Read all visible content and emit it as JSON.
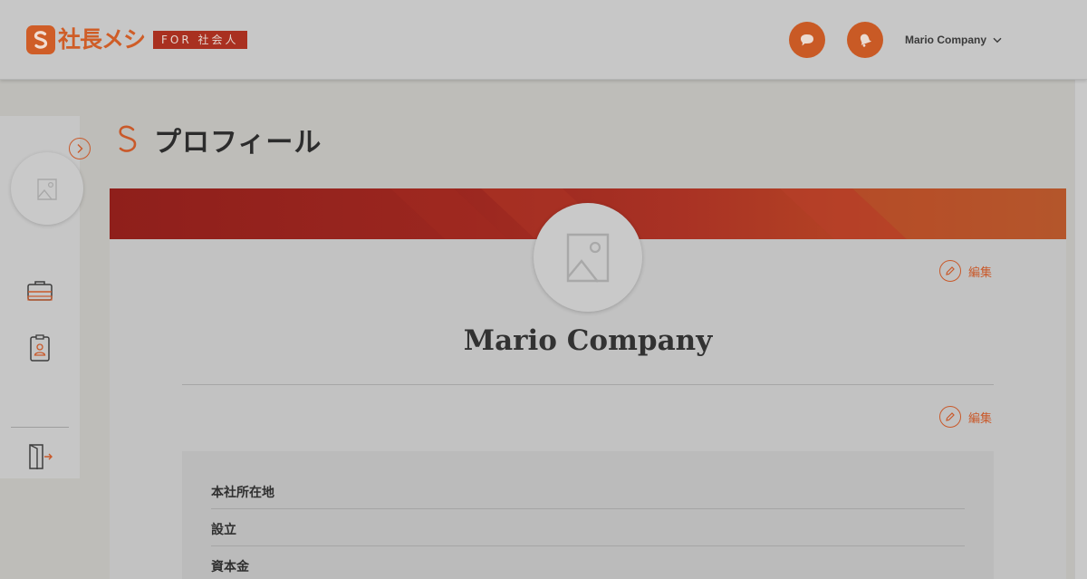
{
  "header": {
    "logo_text": "社長メシ",
    "logo_badge": "FOR 社会人",
    "user_name": "Mario Company"
  },
  "page": {
    "title": "プロフィール"
  },
  "profile": {
    "company_name": "Mario Company",
    "edit_label_top": "編集",
    "edit_label_info": "編集",
    "info_rows": [
      {
        "label": "本社所在地"
      },
      {
        "label": "設立"
      },
      {
        "label": "資本金"
      }
    ]
  },
  "colors": {
    "accent": "#c9592a",
    "banner_dark": "#8f1f1b",
    "banner_light": "#b45a2c"
  },
  "icons": {
    "logo": "shacho-meshi-logo-icon",
    "message": "message-icon",
    "notification": "bell-icon",
    "dropdown": "chevron-down-icon",
    "sidebar_toggle": "chevron-right-icon",
    "sidebar_job": "briefcase-icon",
    "sidebar_profile": "id-badge-icon",
    "sidebar_logout": "logout-icon",
    "avatar_placeholder": "image-placeholder-icon",
    "edit": "pencil-icon"
  }
}
